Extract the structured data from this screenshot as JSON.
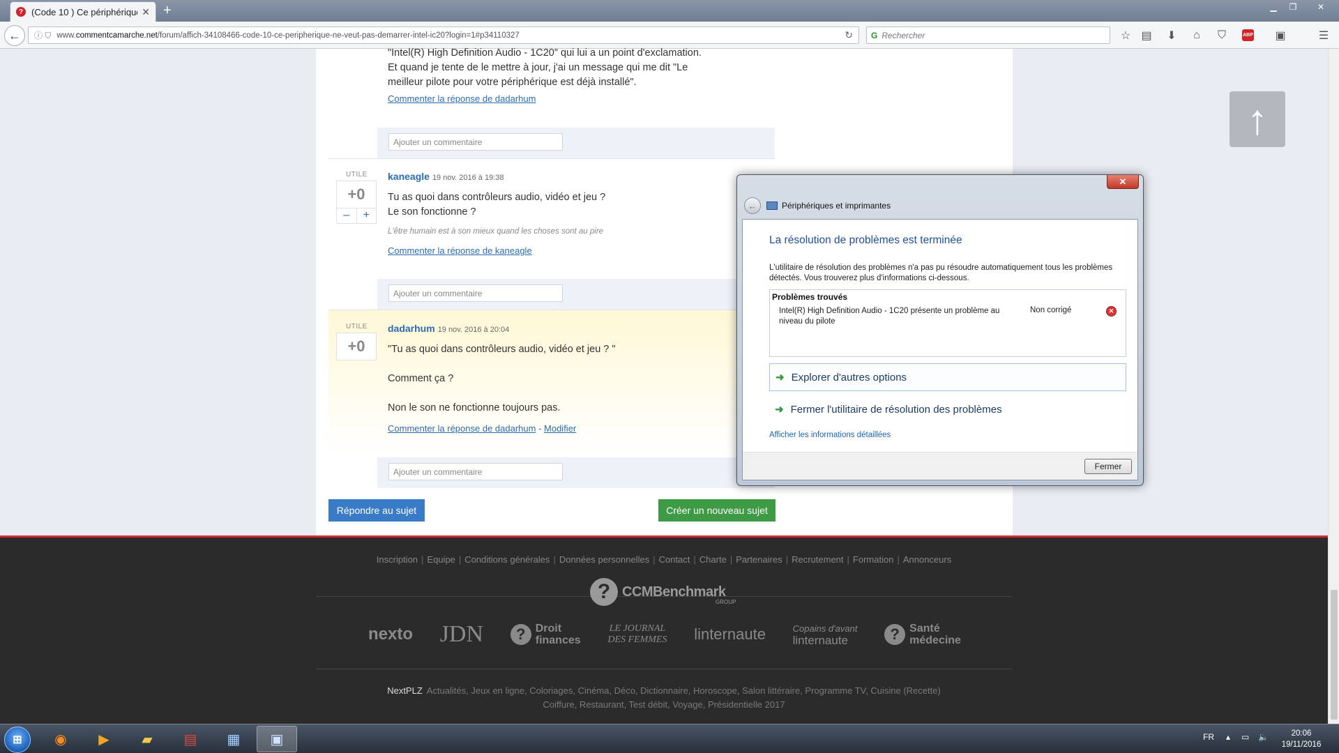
{
  "browser": {
    "tab_title": "(Code 10 ) Ce périphérique...",
    "url_prefix": "www.",
    "url_domain": "commentcamarche.net",
    "url_path": "/forum/affich-34108466-code-10-ce-peripherique-ne-veut-pas-demarrer-intel-ic20?login=1#p34110327",
    "search_placeholder": "Rechercher"
  },
  "thread": {
    "first_post_text_1": "\"Intel(R) High Definition Audio - 1C20\" qui lui a un point d'exclamation.",
    "first_post_text_2": "Et quand je tente de le mettre à jour, j'ai un message qui me dit \"Le",
    "first_post_text_3": "meilleur pilote pour votre périphérique est déjà installé\".",
    "first_comment_link": "Commenter la réponse de dadarhum",
    "add_comment_placeholder": "Ajouter un commentaire",
    "utile_label": "UTILE",
    "posts": [
      {
        "author": "kaneagle",
        "date": "19 nov. 2016 à 19:38",
        "votes": "+0",
        "minus": "–",
        "plus": "+",
        "line1": "Tu as quoi dans contrôleurs audio, vidéo et jeu ?",
        "line2": "Le son fonctionne ?",
        "signature": "L'être humain est à son mieux quand les choses sont au pire",
        "comment_link": "Commenter la réponse de kaneagle"
      },
      {
        "author": "dadarhum",
        "date": "19 nov. 2016 à 20:04",
        "votes": "+0",
        "line1": "\"Tu as quoi dans contrôleurs audio, vidéo et jeu ? \"",
        "line2": "Comment ça ?",
        "line3": "Non le son ne fonctionne toujours pas.",
        "comment_link": "Commenter la réponse de dadarhum",
        "separator": " - ",
        "edit_link": "Modifier"
      }
    ],
    "reply_button": "Répondre au sujet",
    "new_topic_button": "Créer un nouveau sujet"
  },
  "footer": {
    "links": [
      "Inscription",
      "Equipe",
      "Conditions générales",
      "Données personnelles",
      "Contact",
      "Charte",
      "Partenaires",
      "Recrutement",
      "Formation",
      "Annonceurs"
    ],
    "link_separator": "|",
    "brand": "CCMBenchmark",
    "brand_group": "GROUP",
    "logos": {
      "nexto": "nexto",
      "jdn": "JDN",
      "droit_1": "Droit",
      "droit_2": "finances",
      "jf_1": "LE JOURNAL",
      "jf_2": "DES FEMMES",
      "linternaute": "linternaute",
      "copains_1": "Copains d'avant",
      "copains_2": "linternaute",
      "sante_1": "Santé",
      "sante_2": "médecine"
    },
    "nextplz": "NextPLZ",
    "line1": "Actualités, Jeux en ligne, Coloriages, Cinéma, Déco, Dictionnaire, Horoscope, Salon littéraire, Programme TV, Cuisine (Recette)",
    "line2": "Coiffure, Restaurant, Test débit, Voyage, Présidentielle 2017"
  },
  "dialog": {
    "window_title": "Périphériques et imprimantes",
    "heading": "La résolution de problèmes est terminée",
    "description": "L'utilitaire de résolution des problèmes n'a pas pu résoudre automatiquement tous les problèmes détectés. Vous trouverez plus d'informations ci-dessous.",
    "problems_heading": "Problèmes trouvés",
    "problem_text": "Intel(R) High Definition Audio - 1C20 présente un problème au niveau du pilote",
    "problem_status": "Non corrigé",
    "option_explore": "Explorer d'autres options",
    "option_close": "Fermer l'utilitaire de résolution des problèmes",
    "details_link": "Afficher les informations détaillées",
    "close_button": "Fermer"
  },
  "taskbar": {
    "language": "FR",
    "time": "20:06",
    "date": "19/11/2016"
  },
  "colors": {
    "link_blue": "#2b6cb0",
    "reply_button": "#3a7bc8",
    "new_topic_button": "#3f9a45",
    "footer_accent": "#d22b2b"
  }
}
